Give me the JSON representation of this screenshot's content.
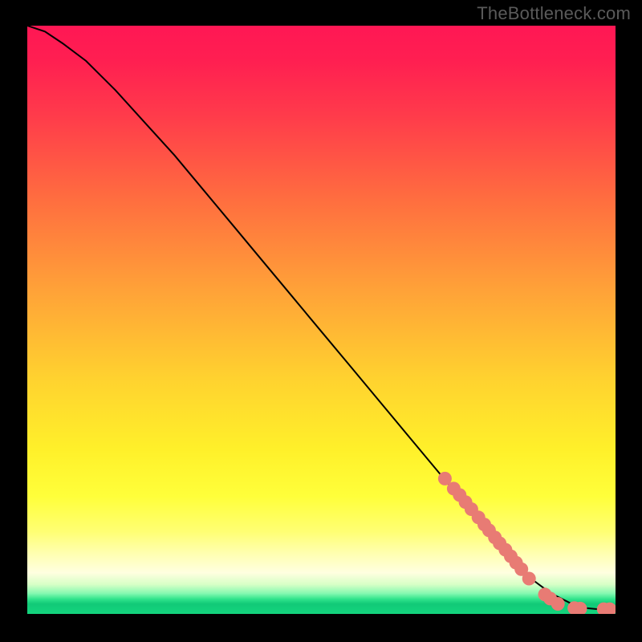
{
  "watermark": "TheBottleneck.com",
  "colors": {
    "frame": "#000000",
    "curve": "#000000",
    "marker": "#e87b74",
    "watermark": "#5a5a5a"
  },
  "chart_data": {
    "type": "line",
    "title": "",
    "xlabel": "",
    "ylabel": "",
    "xlim": [
      0,
      100
    ],
    "ylim": [
      0,
      100
    ],
    "grid": false,
    "legend": false,
    "annotations": [],
    "series": [
      {
        "name": "curve",
        "x": [
          0,
          3,
          6,
          10,
          15,
          20,
          25,
          30,
          35,
          40,
          45,
          50,
          55,
          60,
          65,
          70,
          75,
          80,
          83,
          85,
          87,
          89,
          91,
          93,
          95,
          97,
          99,
          100
        ],
        "y": [
          100,
          99,
          97,
          94,
          89,
          83.5,
          78,
          72,
          66,
          60,
          54,
          48,
          42,
          36,
          30,
          24,
          18,
          12,
          8.5,
          6.5,
          5,
          3.5,
          2.5,
          1.5,
          1,
          0.8,
          0.7,
          0.7
        ]
      },
      {
        "name": "markers",
        "type": "scatter",
        "x": [
          71,
          72.5,
          73.5,
          74.5,
          75.5,
          76.7,
          77.7,
          78.5,
          79.5,
          80.3,
          81.3,
          82.2,
          83.1,
          84.0,
          85.3,
          88.0,
          88.9,
          90.2,
          93.0,
          94.0,
          98.0,
          99.0
        ],
        "y": [
          23.0,
          21.3,
          20.2,
          19.0,
          17.8,
          16.4,
          15.2,
          14.2,
          13.0,
          12.0,
          10.9,
          9.8,
          8.7,
          7.6,
          6.0,
          3.3,
          2.6,
          1.7,
          1.0,
          0.9,
          0.8,
          0.8
        ]
      }
    ]
  }
}
